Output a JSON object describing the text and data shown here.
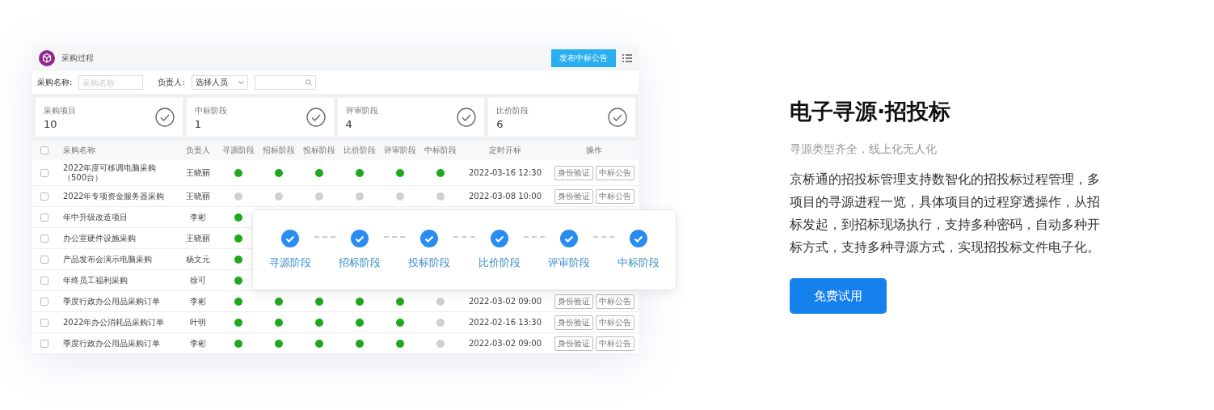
{
  "app": {
    "title": "采购过程",
    "publish_button": "发布中标公告",
    "filters": {
      "name_label": "采购名称:",
      "name_placeholder": "采购名称",
      "owner_label": "负责人:",
      "owner_value": "选择人员"
    },
    "stats": [
      {
        "label": "采购项目",
        "value": "10"
      },
      {
        "label": "中标阶段",
        "value": "1"
      },
      {
        "label": "评审阶段",
        "value": "4"
      },
      {
        "label": "比价阶段",
        "value": "6"
      }
    ],
    "table": {
      "select_all": {
        "checked": false
      },
      "columns": [
        "采购名称",
        "负责人",
        "寻源阶段",
        "招标阶段",
        "投标阶段",
        "比价阶段",
        "评审阶段",
        "中标阶段",
        "定时开标",
        "操作"
      ],
      "rows": [
        {
          "checked": false,
          "name": "2022年度可移调电脑采购（500台）",
          "owner": "王晓丽",
          "stages": [
            {
              "done": true
            },
            {
              "done": true
            },
            {
              "done": true
            },
            {
              "done": true
            },
            {
              "done": true
            },
            {
              "done": true
            }
          ],
          "time": "2022-03-16 12:30",
          "actions": [
            "身份验证",
            "中标公告"
          ]
        },
        {
          "checked": false,
          "name": "2022年专项资金服务器采购",
          "owner": "王晓丽",
          "stages": [
            {
              "done": false
            },
            {
              "done": false
            },
            {
              "done": false
            },
            {
              "done": false
            },
            {
              "done": false
            },
            {
              "done": false
            }
          ],
          "time": "2022-03-08 10:00",
          "actions": [
            "身份验证",
            "中标公告"
          ]
        },
        {
          "checked": false,
          "name": "年中升级改造项目",
          "owner": "李彬",
          "stages": [
            {
              "done": true
            }
          ]
        },
        {
          "checked": false,
          "name": "办公室硬件设施采购",
          "owner": "王晓丽",
          "stages": [
            {
              "done": true
            }
          ]
        },
        {
          "checked": false,
          "name": "产品发布会演示电脑采购",
          "owner": "杨文元",
          "stages": [
            {
              "done": true
            }
          ]
        },
        {
          "checked": false,
          "name": "年终员工福利采购",
          "owner": "徐可",
          "stages": [
            {
              "done": true
            }
          ]
        },
        {
          "checked": false,
          "name": "季度行政办公用品采购订单",
          "owner": "李彬",
          "stages": [
            {
              "done": true
            },
            {
              "done": true
            },
            {
              "done": true
            },
            {
              "done": true
            },
            {
              "done": true
            },
            {
              "done": false
            }
          ],
          "time": "2022-03-02 09:00",
          "actions": [
            "身份验证",
            "中标公告"
          ]
        },
        {
          "checked": false,
          "name": "2022年办公消耗品采购订单",
          "owner": "叶明",
          "stages": [
            {
              "done": true
            },
            {
              "done": true
            },
            {
              "done": true
            },
            {
              "done": true
            },
            {
              "done": true
            },
            {
              "done": false
            }
          ],
          "time": "2022-02-16 13:30",
          "actions": [
            "身份验证",
            "中标公告"
          ]
        },
        {
          "checked": false,
          "name": "季度行政办公用品采购订单",
          "owner": "李彬",
          "stages": [
            {
              "done": true
            },
            {
              "done": true
            },
            {
              "done": true
            },
            {
              "done": true
            },
            {
              "done": true
            },
            {
              "done": false
            }
          ],
          "time": "2022-03-02 09:00",
          "actions": [
            "身份验证",
            "中标公告"
          ]
        }
      ]
    }
  },
  "steps": [
    {
      "label": "寻源阶段",
      "done": true
    },
    {
      "label": "招标阶段",
      "done": true
    },
    {
      "label": "投标阶段",
      "done": true
    },
    {
      "label": "比价阶段",
      "done": true
    },
    {
      "label": "评审阶段",
      "done": true
    },
    {
      "label": "中标阶段",
      "done": true
    }
  ],
  "feature": {
    "title": "电子寻源·招投标",
    "subtitle": "寻源类型齐全，线上化无人化",
    "description": "京桥通的招投标管理支持数智化的招投标过程管理，多项目的寻源进程一览，具体项目的过程穿透操作，从招标发起，到招标现场执行，支持多种密码，自动多种开标方式，支持多种寻源方式，实现招投标文件电子化。",
    "button": "免费试用"
  }
}
